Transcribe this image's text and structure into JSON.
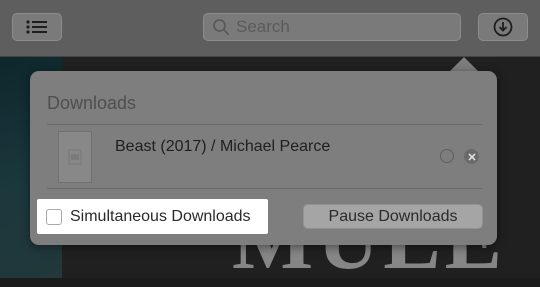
{
  "toolbar": {
    "search_placeholder": "Search"
  },
  "background": {
    "poster_text": "MULE"
  },
  "popover": {
    "title": "Downloads",
    "item": {
      "title": "Beast (2017) / Michael Pearce"
    },
    "simultaneous_label": "Simultaneous Downloads",
    "pause_label": "Pause Downloads"
  },
  "icons": {
    "list": "list-icon",
    "search": "search-icon",
    "download": "download-icon",
    "cancel": "close-icon"
  }
}
